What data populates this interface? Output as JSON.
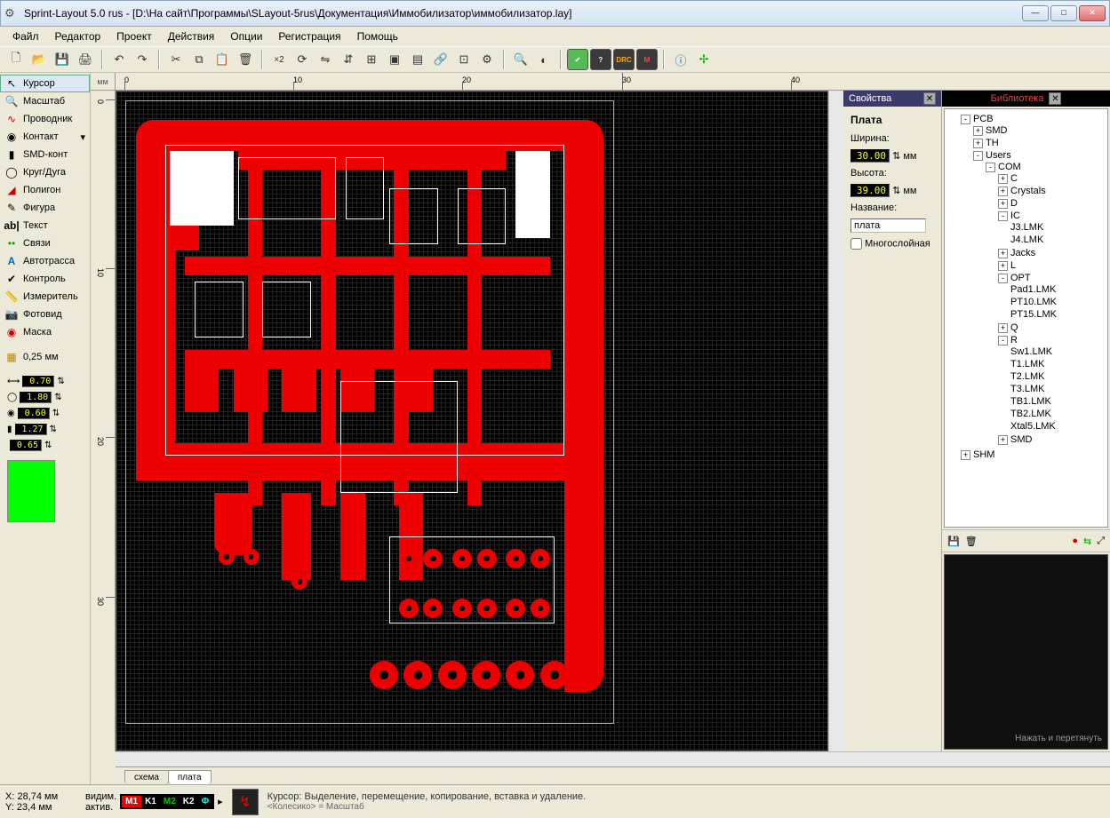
{
  "title": "Sprint-Layout 5.0 rus    - [D:\\На сайт\\Программы\\SLayout-5rus\\Документация\\Иммобилизатор\\иммобилизатор.lay]",
  "menu": [
    "Файл",
    "Редактор",
    "Проект",
    "Действия",
    "Опции",
    "Регистрация",
    "Помощь"
  ],
  "winbtns": {
    "min": "—",
    "max": "□",
    "close": "✕"
  },
  "ruler_unit": "мм",
  "hruler": [
    "0",
    "10",
    "20",
    "30",
    "40"
  ],
  "vruler": [
    "0",
    "10",
    "20",
    "30"
  ],
  "tools": [
    {
      "icon": "↖",
      "label": "Курсор",
      "sel": true
    },
    {
      "icon": "🔍",
      "label": "Масштаб"
    },
    {
      "icon": "∿",
      "label": "Проводник"
    },
    {
      "icon": "◉",
      "label": "Контакт",
      "drop": true
    },
    {
      "icon": "▮",
      "label": "SMD-конт"
    },
    {
      "icon": "◯",
      "label": "Круг/Дуга"
    },
    {
      "icon": "▰",
      "label": "Полигон"
    },
    {
      "icon": "✎",
      "label": "Фигура"
    },
    {
      "icon": "ab|",
      "label": "Текст"
    },
    {
      "icon": "••",
      "label": "Связи"
    },
    {
      "icon": "A",
      "label": "Автотрасса"
    },
    {
      "icon": "✔",
      "label": "Контроль"
    },
    {
      "icon": "📏",
      "label": "Измеритель"
    },
    {
      "icon": "📷",
      "label": "Фотовид"
    },
    {
      "icon": "◉",
      "label": "Маска"
    }
  ],
  "grid_label": "0,25 мм",
  "nums": [
    "0.70",
    "1.80",
    "0.60",
    "1.27",
    "0.65"
  ],
  "props": {
    "panel": "Свойства",
    "title": "Плата",
    "width_label": "Ширина:",
    "width": "30.00",
    "height_label": "Высота:",
    "height": "39.00",
    "unit": "мм",
    "name_label": "Название:",
    "name": "плата",
    "multi": "Многослойная"
  },
  "lib": {
    "panel": "Библиотека",
    "hint": "Нажать и перетянуть",
    "tree": {
      "root": "PCB",
      "smd": "SMD",
      "th": "TH",
      "users": "Users",
      "com": "COM",
      "items_pre": [
        "C",
        "Crystals",
        "D",
        "IC"
      ],
      "ic": [
        "J3.LMK",
        "J4.LMK"
      ],
      "items_mid": [
        "Jacks",
        "L",
        "OPT"
      ],
      "opt": [
        "Pad1.LMK",
        "PT10.LMK",
        "PT15.LMK"
      ],
      "q": "Q",
      "r": "R",
      "r_items": [
        "Sw1.LMK",
        "T1.LMK",
        "T2.LMK",
        "T3.LMK",
        "TB1.LMK",
        "TB2.LMK",
        "Xtal5.LMK"
      ],
      "smd2": "SMD",
      "shm": "SHM"
    }
  },
  "layers": {
    "vis": "видим.",
    "act": "актив.",
    "m1": "M1",
    "k1": "K1",
    "m2": "M2",
    "k2": "K2",
    "f": "Ф"
  },
  "tabs": [
    "схема",
    "плата"
  ],
  "status": {
    "x_label": "X:",
    "x": "28,74 мм",
    "y_label": "Y:",
    "y": "23,4 мм",
    "hint1": "Курсор: Выделение, перемещение, копирование, вставка и удаление.",
    "hint2": "<Колесико> = Масштаб"
  }
}
